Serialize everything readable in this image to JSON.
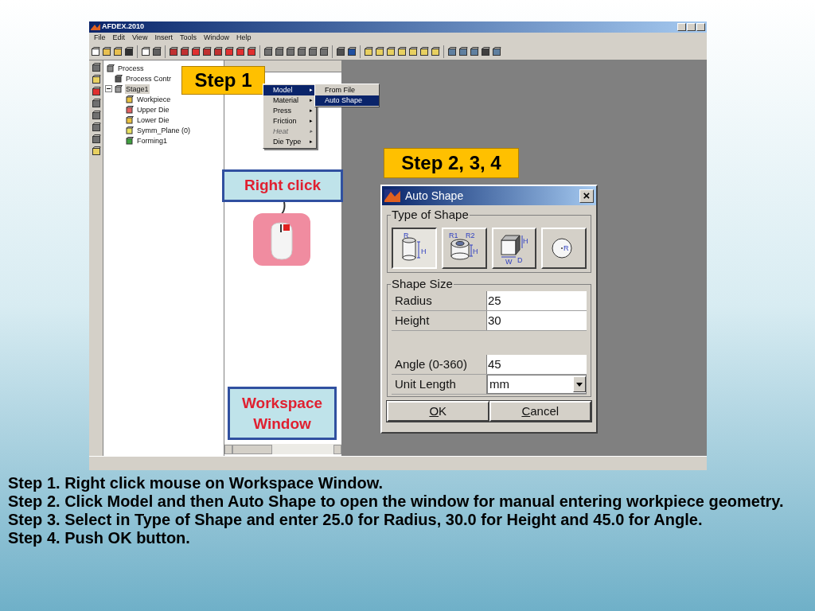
{
  "window": {
    "title": "AFDEX.2010"
  },
  "menu": [
    "File",
    "Edit",
    "View",
    "Insert",
    "Tools",
    "Window",
    "Help"
  ],
  "tree": {
    "label": "Process",
    "children": [
      {
        "label": "Process Contr",
        "selected": false
      },
      {
        "label": "Stage1",
        "selected": true,
        "expanded": true,
        "children": [
          {
            "label": "Workpiece",
            "selected": false
          },
          {
            "label": "Upper Die",
            "selected": false
          },
          {
            "label": "Lower Die",
            "selected": false
          },
          {
            "label": "Symm_Plane (0)",
            "selected": false
          },
          {
            "label": "Forming1",
            "selected": false
          }
        ]
      }
    ]
  },
  "context_menu": [
    {
      "label": "Model",
      "selected": true,
      "disabled": false,
      "arrow": "▸"
    },
    {
      "label": "Material",
      "selected": false,
      "disabled": false,
      "arrow": "▸"
    },
    {
      "label": "Press",
      "selected": false,
      "disabled": false,
      "arrow": "▸"
    },
    {
      "label": "Friction",
      "selected": false,
      "disabled": false,
      "arrow": "▸"
    },
    {
      "label": "Heat",
      "selected": false,
      "disabled": true,
      "arrow": "▸"
    },
    {
      "label": "Die Type",
      "selected": false,
      "disabled": false,
      "arrow": "▸"
    }
  ],
  "submenu": [
    {
      "label": "From File",
      "selected": false
    },
    {
      "label": "Auto Shape",
      "selected": true
    }
  ],
  "callouts": {
    "step1": "Step 1",
    "step234": "Step 2, 3, 4",
    "right_click": "Right click",
    "workspace": "Workspace Window"
  },
  "dialog": {
    "title": "Auto Shape",
    "close": "×",
    "shape_group": "Type of Shape",
    "shapes": [
      {
        "kind": "cylinder",
        "selected": true,
        "labels": [
          "R",
          "H"
        ]
      },
      {
        "kind": "ring",
        "selected": false,
        "labels": [
          "R1",
          "R2",
          "H"
        ]
      },
      {
        "kind": "box",
        "selected": false,
        "labels": [
          "H",
          "W",
          "D"
        ]
      },
      {
        "kind": "sphere",
        "selected": false,
        "labels": [
          "R"
        ]
      }
    ],
    "size_group": "Shape Size",
    "fields": [
      {
        "kind": "text",
        "label": "Radius",
        "value": "25"
      },
      {
        "kind": "text",
        "label": "Height",
        "value": "30"
      },
      {
        "kind": "gap"
      },
      {
        "kind": "text",
        "label": "Angle (0-360)",
        "value": "45"
      },
      {
        "kind": "select",
        "label": "Unit Length",
        "value": "mm"
      }
    ],
    "buttons": [
      "OK",
      "Cancel"
    ]
  },
  "steps": [
    "Step 1. Right click mouse on Workspace Window.",
    "Step 2. Click Model and then Auto Shape to open the window for manual entering workpiece geometry.",
    "Step 3. Select in Type of Shape and enter 25.0 for Radius, 30.0 for Height and 45.0 for Angle.",
    "Step 4. Push OK button."
  ]
}
